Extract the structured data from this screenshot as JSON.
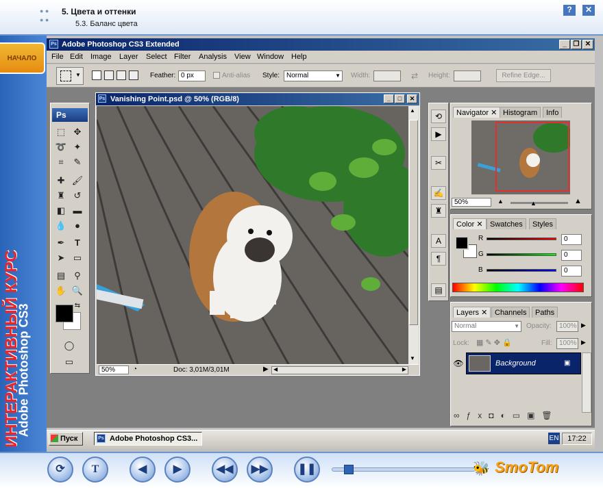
{
  "course": {
    "chapter": "5. Цвета и оттенки",
    "section": "5.3. Баланс цвета",
    "help_label": "?",
    "close_label": "✕",
    "start_label": "НАЧАЛО",
    "vertical_title": "ИНТЕРАКТИВНЫЙ КУРС",
    "vertical_subtitle": "Adobe Photoshop CS3",
    "logo": "SmoTom",
    "controls": [
      "repeat",
      "text",
      "prev",
      "next",
      "rewind",
      "forward",
      "pause"
    ]
  },
  "app": {
    "title": "Adobe Photoshop CS3 Extended",
    "menu": [
      "File",
      "Edit",
      "Image",
      "Layer",
      "Select",
      "Filter",
      "Analysis",
      "View",
      "Window",
      "Help"
    ],
    "options": {
      "feather_label": "Feather:",
      "feather_value": "0 px",
      "antialias_label": "Anti-alias",
      "style_label": "Style:",
      "style_value": "Normal",
      "width_label": "Width:",
      "height_label": "Height:",
      "refine_label": "Refine Edge..."
    }
  },
  "toolbox": {
    "logo": "Ps"
  },
  "document": {
    "title": "Vanishing Point.psd @ 50% (RGB/8)",
    "zoom": "50%",
    "doc_size": "Doc: 3,01M/3,01M"
  },
  "navigator": {
    "tabs": [
      "Navigator",
      "Histogram",
      "Info"
    ],
    "zoom": "50%"
  },
  "color": {
    "tabs": [
      "Color",
      "Swatches",
      "Styles"
    ],
    "r_label": "R",
    "g_label": "G",
    "b_label": "B",
    "r_value": "0",
    "g_value": "0",
    "b_value": "0"
  },
  "layers": {
    "tabs": [
      "Layers",
      "Channels",
      "Paths"
    ],
    "blend_mode": "Normal",
    "opacity_label": "Opacity:",
    "opacity_value": "100%",
    "lock_label": "Lock:",
    "fill_label": "Fill:",
    "fill_value": "100%",
    "layer_name": "Background",
    "footer_icons": [
      "link-icon",
      "fx-icon",
      "mask-icon",
      "adjustment-icon",
      "folder-icon",
      "new-layer-icon",
      "trash-icon"
    ]
  },
  "taskbar": {
    "start_label": "Пуск",
    "task_label": "Adobe Photoshop CS3...",
    "lang": "EN",
    "clock": "17:22"
  },
  "colors": {
    "title_bar": "#0a246a",
    "course_blue": "#3b6fb8",
    "accent_orange": "#e58c10",
    "vertical_red": "#e8262b"
  }
}
